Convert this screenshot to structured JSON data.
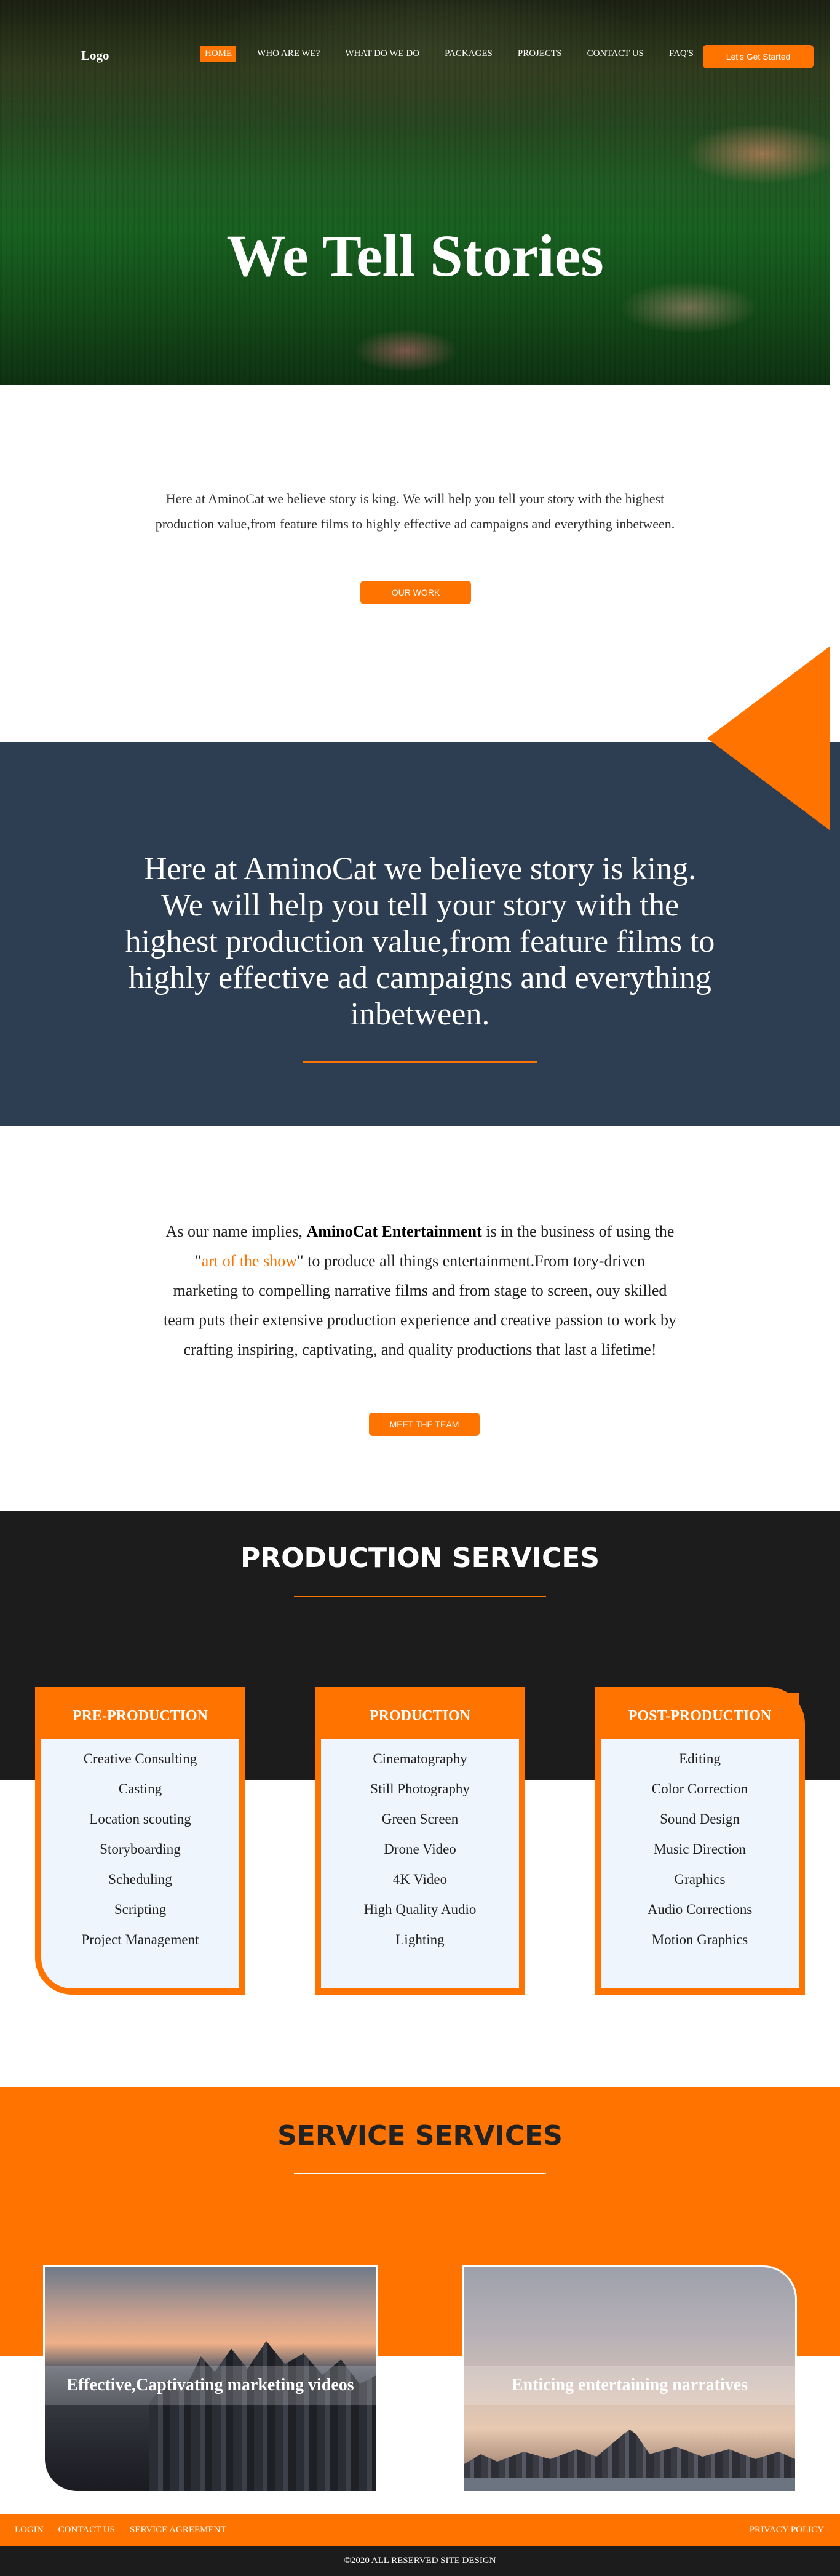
{
  "header": {
    "logo": "Logo",
    "nav": [
      "HOME",
      "WHO ARE WE?",
      "WHAT DO WE DO",
      "PACKAGES",
      "PROJECTS",
      "CONTACT US",
      "FAQ'S"
    ],
    "cta": "Let's Get Started"
  },
  "hero": {
    "title": "We Tell Stories"
  },
  "intro": {
    "text": "Here at AminoCat we believe story is king. We will help you tell your story with the highest production value,from feature films to highly effective ad campaigns and everything inbetween.",
    "button": "OUR WORK"
  },
  "quote": {
    "text": "Here at AminoCat we believe story is king. We will help you tell your story with the highest production value,from feature films to highly effective ad campaigns and everything inbetween."
  },
  "about": {
    "before_name": "As our name implies, ",
    "name": "AminoCat Entertainment",
    "after_name": " is in the business of using the \"",
    "highlight": "art of the show",
    "rest": "\" to produce all things entertainment.From tory-driven marketing to compelling narrative films and from stage to screen, ouy skilled team puts their extensive production experience and creative passion to work by crafting inspiring, captivating, and quality productions that last a lifetime!",
    "button": "MEET THE TEAM"
  },
  "production": {
    "title": "PRODUCTION SERVICES",
    "cards": [
      {
        "title": "PRE-PRODUCTION",
        "items": [
          "Creative Consulting",
          "Casting",
          "Location scouting",
          "Storyboarding",
          "Scheduling",
          "Scripting",
          "Project Management"
        ]
      },
      {
        "title": "PRODUCTION",
        "items": [
          "Cinematography",
          "Still Photography",
          "Green Screen",
          "Drone Video",
          "4K Video",
          "High Quality Audio",
          "Lighting"
        ]
      },
      {
        "title": "POST-PRODUCTION",
        "items": [
          "Editing",
          "Color Correction",
          "Sound Design",
          "Music Direction",
          "Graphics",
          "Audio Corrections",
          "Motion Graphics"
        ]
      }
    ]
  },
  "services": {
    "title": "SERVICE SERVICES",
    "cards": [
      {
        "label": "Effective,Captivating marketing videos"
      },
      {
        "label": "Enticing entertaining narratives"
      }
    ]
  },
  "footer": {
    "links": [
      "LOGIN",
      "CONTACT US",
      "SERVICE AGREEMENT"
    ],
    "privacy": "PRIVACY POLICY",
    "copyright": "©2020 ALL RESERVED SITE DESIGN"
  },
  "colors": {
    "accent": "#ff7300",
    "band": "#2e3e52",
    "dark": "#1c1c1c"
  }
}
